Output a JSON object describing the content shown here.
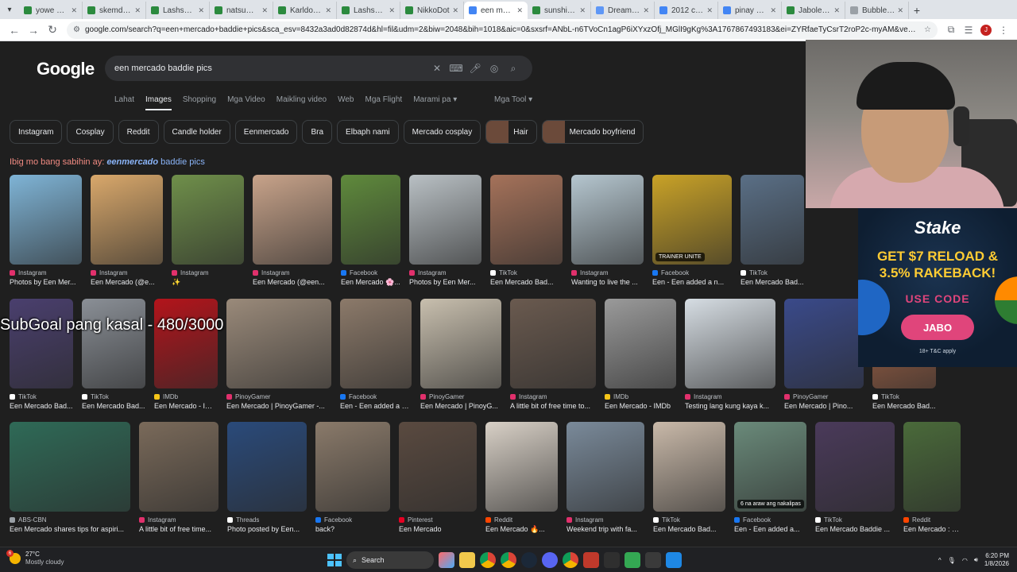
{
  "tabs": [
    {
      "title": "yowe Stre",
      "color": "#2b8a3e",
      "active": false
    },
    {
      "title": "skemdota",
      "color": "#2b8a3e",
      "active": false
    },
    {
      "title": "Lashsegw",
      "color": "#2b8a3e",
      "active": false
    },
    {
      "title": "natsumidi",
      "color": "#2b8a3e",
      "active": false
    },
    {
      "title": "Karldotaa",
      "color": "#2b8a3e",
      "active": false
    },
    {
      "title": "Lashsegw",
      "color": "#2b8a3e",
      "active": false
    },
    {
      "title": "NikkoDot",
      "color": "#2b8a3e",
      "active": false
    },
    {
      "title": "een merca",
      "color": "#4285f4",
      "active": true
    },
    {
      "title": "sunshinen",
      "color": "#2b8a3e",
      "active": false
    },
    {
      "title": "DreamLea",
      "color": "#5e97f6",
      "active": false
    },
    {
      "title": "2012 cale",
      "color": "#4285f4",
      "active": false
    },
    {
      "title": "pinay 201",
      "color": "#4285f4",
      "active": false
    },
    {
      "title": "JaboleroD",
      "color": "#2b8a3e",
      "active": false
    },
    {
      "title": "Bubble G",
      "color": "#9aa0a6",
      "active": false
    }
  ],
  "address": {
    "url": "google.com/search?q=een+mercado+baddie+pics&sca_esv=8432a3ad0d82874d&hl=fil&udm=2&biw=2048&bih=1018&aic=0&sxsrf=ANbL-n6TVoCn1agP6iXYxzOfj_MGlI9gKg%3A1767867493183&ei=ZYRfaeTyCsrT2roP2c-myAM&ved=0ahUKEwikuCPP2_uRAxXKqVYB..."
  },
  "search": {
    "logo": "Google",
    "query": "een mercado baddie pics"
  },
  "nav_tabs": [
    "Lahat",
    "Images",
    "Shopping",
    "Mga Video",
    "Maikling video",
    "Web",
    "Mga Flight",
    "Marami pa ▾"
  ],
  "nav_active": "Images",
  "tools_label": "Mga Tool ▾",
  "chips": [
    {
      "label": "Instagram",
      "thumb": false
    },
    {
      "label": "Cosplay",
      "thumb": false
    },
    {
      "label": "Reddit",
      "thumb": false
    },
    {
      "label": "Candle holder",
      "thumb": false
    },
    {
      "label": "Eenmercado",
      "thumb": false
    },
    {
      "label": "Bra",
      "thumb": false
    },
    {
      "label": "Elbaph nami",
      "thumb": false
    },
    {
      "label": "Mercado cosplay",
      "thumb": false
    },
    {
      "label": "Hair",
      "thumb": true
    },
    {
      "label": "Mercado boyfriend",
      "thumb": true
    }
  ],
  "suggestion": {
    "prefix": "Ibig mo bang sabihin ay: ",
    "corrected": "eenmercado",
    "rest": " baddie pics"
  },
  "rows": [
    [
      {
        "source": "Instagram",
        "title": "Photos by Een Mer...",
        "color": "#7fb4d6",
        "icon": "#e1306c"
      },
      {
        "source": "Instagram",
        "title": "Een Mercado (@e...",
        "color": "#d9a86b",
        "icon": "#e1306c"
      },
      {
        "source": "Instagram",
        "title": "✨",
        "color": "#6f8f4a",
        "icon": "#e1306c"
      },
      {
        "source": "Instagram",
        "title": "Een Mercado (@een...",
        "color": "#c8a38a",
        "icon": "#e1306c"
      },
      {
        "source": "Facebook",
        "title": "Een Mercado 🌸...",
        "color": "#5f8a3c",
        "icon": "#1877f2"
      },
      {
        "source": "Instagram",
        "title": "Photos by Een Mer...",
        "color": "#b9c0c4",
        "icon": "#e1306c"
      },
      {
        "source": "TikTok",
        "title": "Een Mercado Bad...",
        "color": "#a5725a",
        "icon": "#ffffff"
      },
      {
        "source": "Instagram",
        "title": "Wanting to live the ...",
        "color": "#b5c6cf",
        "icon": "#e1306c"
      },
      {
        "source": "Facebook",
        "title": "Een - Een added a n...",
        "color": "#c9a227",
        "icon": "#1877f2",
        "overlay": "TRAINER UNITE"
      },
      {
        "source": "TikTok",
        "title": "Een Mercado Bad...",
        "color": "#5a6f86",
        "icon": "#ffffff"
      }
    ],
    [
      {
        "source": "TikTok",
        "title": "Een Mercado Bad...",
        "color": "#4a3f6e",
        "icon": "#ffffff"
      },
      {
        "source": "TikTok",
        "title": "Een Mercado Bad...",
        "color": "#8a8f96",
        "icon": "#ffffff"
      },
      {
        "source": "IMDb",
        "title": "Een Mercado - IMDb",
        "color": "#b3141b",
        "icon": "#f5c518"
      },
      {
        "source": "PinoyGamer",
        "title": "Een Mercado | PinoyGamer -...",
        "color": "#9a8a7a",
        "icon": "#e1306c"
      },
      {
        "source": "Facebook",
        "title": "Een - Een added a n...",
        "color": "#8c7a6a",
        "icon": "#1877f2"
      },
      {
        "source": "PinoyGamer",
        "title": "Een Mercado | PinoyG...",
        "color": "#c8bfae",
        "icon": "#e1306c"
      },
      {
        "source": "Instagram",
        "title": "A little bit of free time to...",
        "color": "#6a5a4f",
        "icon": "#e1306c"
      },
      {
        "source": "IMDb",
        "title": "Een Mercado - IMDb",
        "color": "#9a9a9a",
        "icon": "#f5c518"
      },
      {
        "source": "Instagram",
        "title": "Testing lang kung kaya k...",
        "color": "#d6dde3",
        "icon": "#e1306c"
      },
      {
        "source": "PinoyGamer",
        "title": "Een Mercado | Pino...",
        "color": "#3a4a8a",
        "icon": "#e1306c"
      },
      {
        "source": "TikTok",
        "title": "Een Mercado Bad...",
        "color": "#b06a4a",
        "icon": "#ffffff"
      }
    ],
    [
      {
        "source": "ABS-CBN",
        "title": "Een Mercado shares tips for aspiri...",
        "color": "#2f6a57",
        "icon": "#9aa0a6"
      },
      {
        "source": "Instagram",
        "title": "A little bit of free time...",
        "color": "#7a6a5a",
        "icon": "#e1306c"
      },
      {
        "source": "Threads",
        "title": "Photo posted by Een...",
        "color": "#2a4a7a",
        "icon": "#ffffff"
      },
      {
        "source": "Facebook",
        "title": "back?",
        "color": "#8a7a6a",
        "icon": "#1877f2"
      },
      {
        "source": "Pinterest",
        "title": "Een Mercado",
        "color": "#5a4a40",
        "icon": "#e60023"
      },
      {
        "source": "Reddit",
        "title": "Een Mercado 🔥...",
        "color": "#d8d0c6",
        "icon": "#ff4500"
      },
      {
        "source": "Instagram",
        "title": "Weekend trip with fa...",
        "color": "#7a8a9a",
        "icon": "#e1306c"
      },
      {
        "source": "TikTok",
        "title": "Een Mercado Bad...",
        "color": "#c9b9a9",
        "icon": "#ffffff"
      },
      {
        "source": "Facebook",
        "title": "Een - Een added a...",
        "color": "#6a8a7a",
        "icon": "#1877f2",
        "overlay": "6 na araw ang nakalipas"
      },
      {
        "source": "TikTok",
        "title": "Een Mercado Baddie ...",
        "color": "#4a3a5a",
        "icon": "#ffffff"
      },
      {
        "source": "Reddit",
        "title": "Een Mercado : r/Cele...",
        "color": "#4a6a3a",
        "icon": "#ff4500"
      }
    ]
  ],
  "overlays": {
    "subgoal": "SubGoal pang kasal - 480/3000",
    "stake": {
      "brand": "Stake",
      "promo_line1": "GET $7 RELOAD &",
      "promo_line2": "3.5% RAKEBACK!",
      "use_code": "USE CODE",
      "code": "JABO",
      "terms": "18+ T&C apply"
    }
  },
  "taskbar": {
    "weather_count": "6",
    "temp": "27°C",
    "condition": "Mostly cloudy",
    "search_label": "Search",
    "time": "6:20 PM",
    "date": "1/8/2026"
  }
}
